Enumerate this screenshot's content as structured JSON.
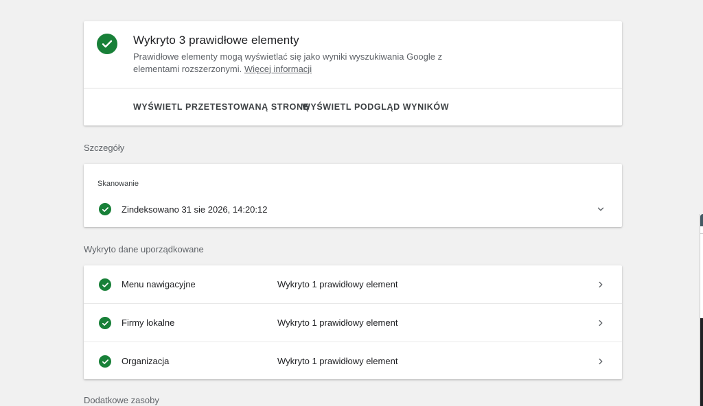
{
  "summary": {
    "title": "Wykryto 3 prawidłowe elementy",
    "description": "Prawidłowe elementy mogą wyświetlać się jako wyniki wyszukiwania Google z elementami rozszerzonymi.",
    "more_link": "Więcej informacji",
    "actions": [
      {
        "label": "WYŚWIETL PRZETESTOWANĄ STRONĘ"
      },
      {
        "label": "WYŚWIETL PODGLĄD WYNIKÓW"
      }
    ]
  },
  "details": {
    "section_label": "Szczegóły",
    "subheading": "Skanowanie",
    "row_text": "Zindeksowano 31 sie 2026, 14:20:12"
  },
  "structured": {
    "section_label": "Wykryto dane uporządkowane",
    "items": [
      {
        "name": "Menu nawigacyjne",
        "status": "Wykryto 1 prawidłowy element"
      },
      {
        "name": "Firmy lokalne",
        "status": "Wykryto 1 prawidłowy element"
      },
      {
        "name": "Organizacja",
        "status": "Wykryto 1 prawidłowy element"
      }
    ]
  },
  "resources": {
    "section_label": "Dodatkowe zasoby"
  },
  "colors": {
    "success": "#188038",
    "background": "#f1f1f1"
  },
  "icons": {
    "success": "check-circle-icon",
    "expand": "chevron-down-icon",
    "open": "chevron-right-icon"
  }
}
